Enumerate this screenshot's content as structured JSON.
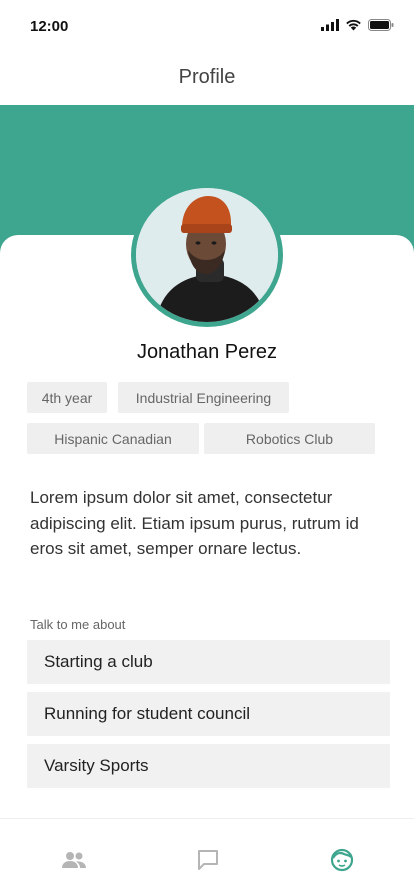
{
  "status_bar": {
    "time": "12:00"
  },
  "nav": {
    "title": "Profile"
  },
  "colors": {
    "accent": "#3ea58e",
    "tag_bg": "#efefef",
    "topic_bg": "#f1f1f1",
    "active_tab": "#3ea58e",
    "inactive_tab": "#b5b5b5"
  },
  "profile": {
    "name": "Jonathan Perez",
    "avatar_icon": "person-photo",
    "tags": [
      "4th year",
      "Industrial Engineering",
      "Hispanic Canadian",
      "Robotics Club"
    ],
    "bio": "Lorem ipsum dolor sit amet, consectetur adipiscing elit. Etiam ipsum purus, rutrum id eros sit amet, semper ornare lectus."
  },
  "talk_about": {
    "label": "Talk to me about",
    "topics": [
      "Starting a club",
      "Running for student council",
      "Varsity Sports"
    ]
  },
  "tab_bar": {
    "tabs": [
      {
        "icon": "people-icon",
        "active": false
      },
      {
        "icon": "chat-icon",
        "active": false
      },
      {
        "icon": "profile-face-icon",
        "active": true
      }
    ]
  }
}
